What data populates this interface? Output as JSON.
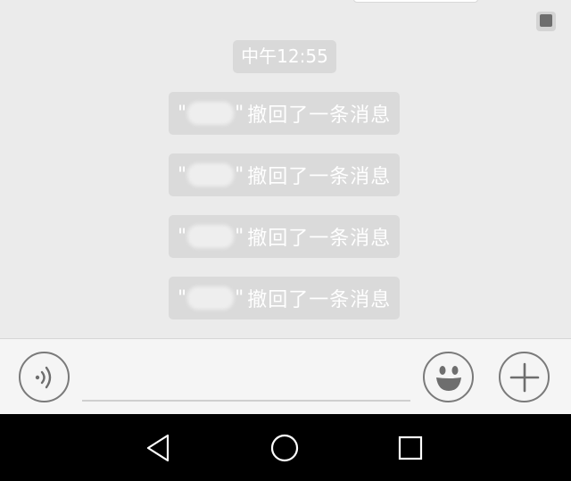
{
  "chat": {
    "timestamp": "中午12:55",
    "recall_notices": [
      {
        "open_quote": "\"",
        "close_quote": "\"",
        "text": "撤回了一条消息"
      },
      {
        "open_quote": "\"",
        "close_quote": "\"",
        "text": "撤回了一条消息"
      },
      {
        "open_quote": "\"",
        "close_quote": "\"",
        "text": "撤回了一条消息"
      },
      {
        "open_quote": "\"",
        "close_quote": "\"",
        "text": "撤回了一条消息"
      }
    ]
  },
  "input_bar": {
    "voice_icon": "voice-icon",
    "emoji_icon": "emoji-icon",
    "plus_icon": "plus-icon",
    "message_placeholder": ""
  },
  "nav_bar": {
    "back_icon": "back-triangle-icon",
    "home_icon": "home-circle-icon",
    "recent_icon": "recent-square-icon"
  }
}
